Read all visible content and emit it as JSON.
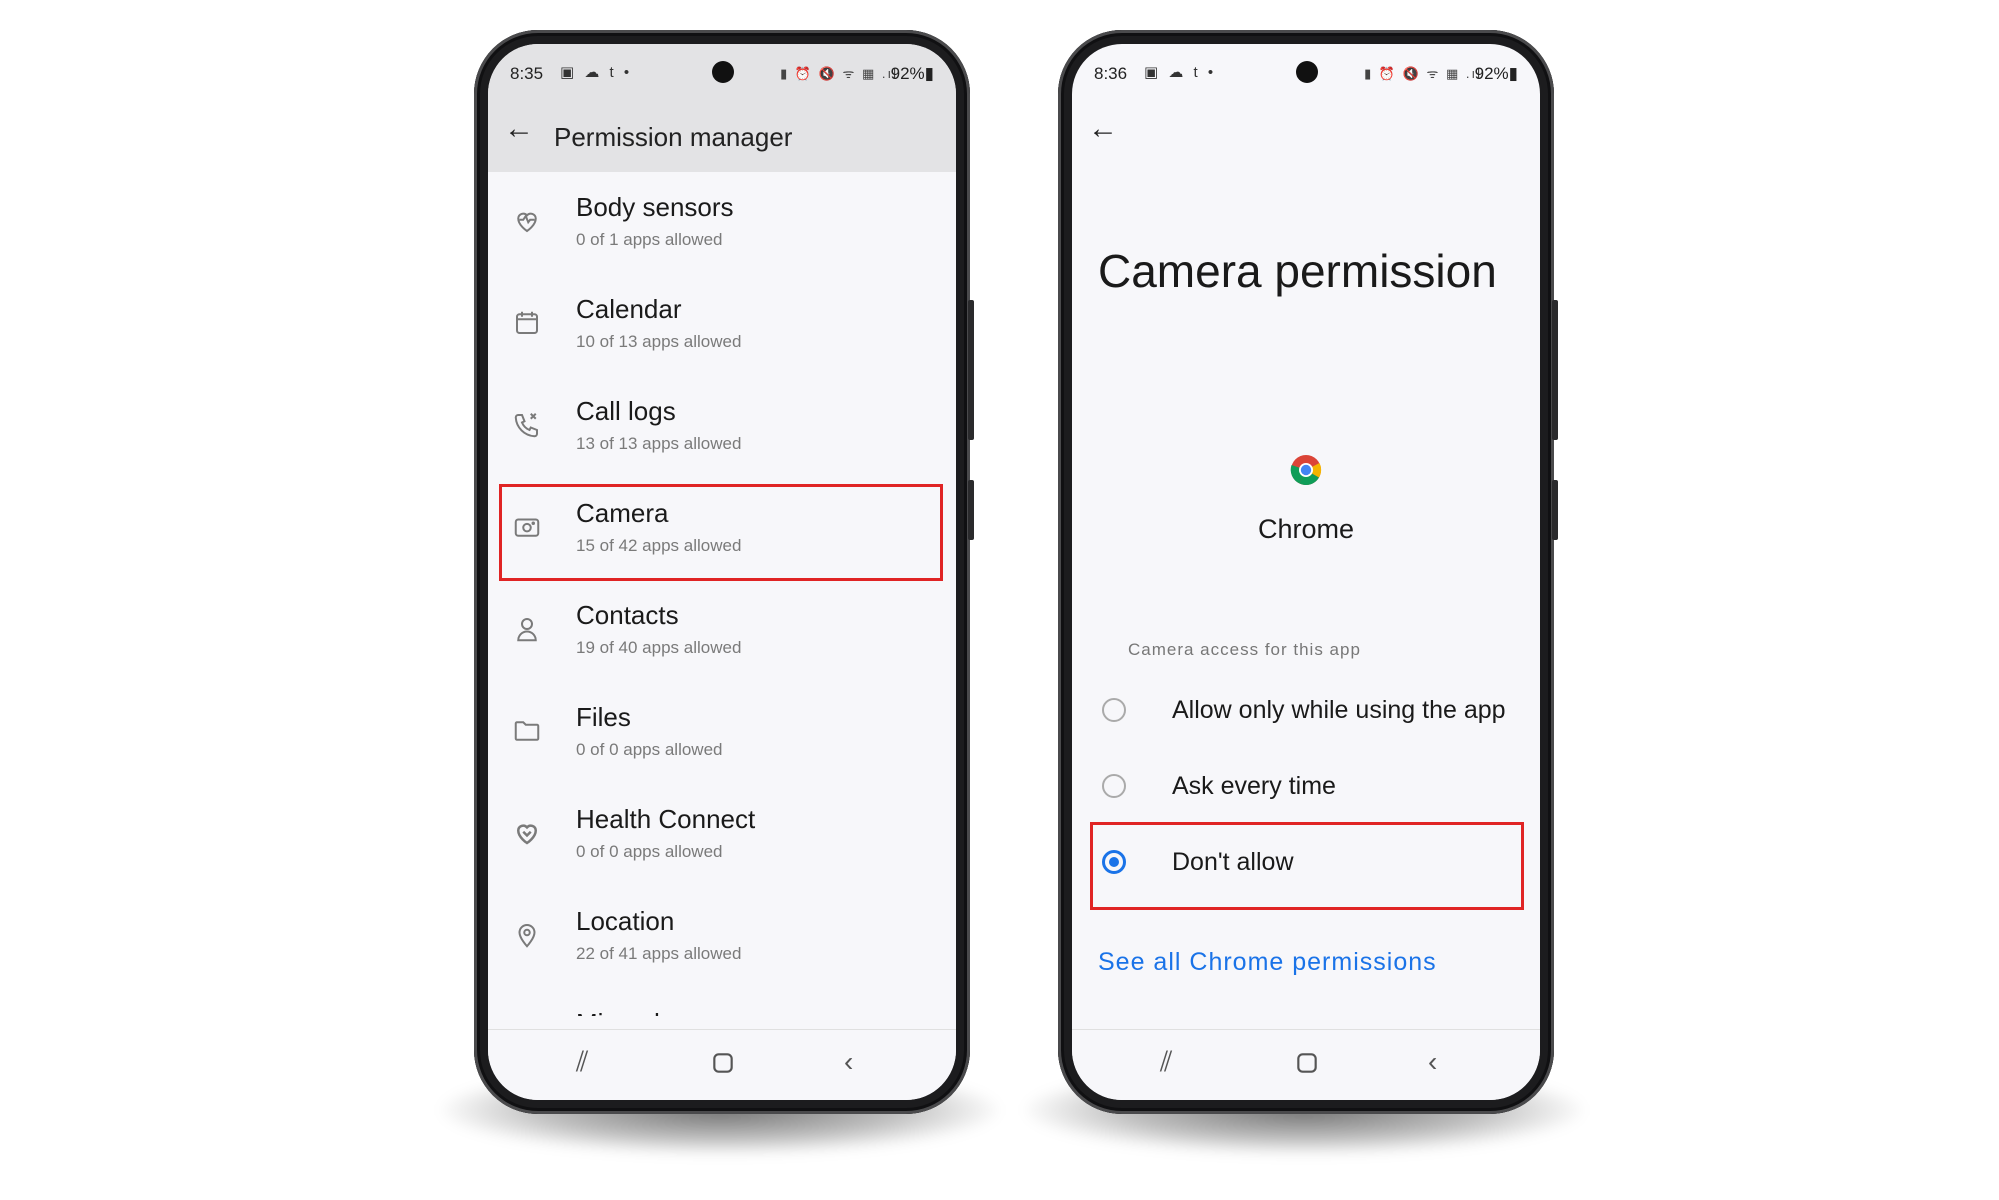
{
  "left_phone": {
    "status": {
      "time": "8:35",
      "left_icons": "▣ ☁ t •",
      "right_icons": "▮ ⏰ 🔇 ᯤ ▦ .ıl",
      "battery": "92%▮"
    },
    "app_bar": {
      "title": "Permission manager"
    },
    "permissions": [
      {
        "title": "Body sensors",
        "subtitle": "0 of 1 apps allowed",
        "icon": "heart-pulse-icon"
      },
      {
        "title": "Calendar",
        "subtitle": "10 of 13 apps allowed",
        "icon": "calendar-icon"
      },
      {
        "title": "Call logs",
        "subtitle": "13 of 13 apps allowed",
        "icon": "call-log-icon"
      },
      {
        "title": "Camera",
        "subtitle": "15 of 42 apps allowed",
        "icon": "camera-icon"
      },
      {
        "title": "Contacts",
        "subtitle": "19 of 40 apps allowed",
        "icon": "person-icon"
      },
      {
        "title": "Files",
        "subtitle": "0 of 0 apps allowed",
        "icon": "folder-icon"
      },
      {
        "title": "Health Connect",
        "subtitle": "0 of 0 apps allowed",
        "icon": "health-connect-icon"
      },
      {
        "title": "Location",
        "subtitle": "22 of 41 apps allowed",
        "icon": "location-pin-icon"
      },
      {
        "title": "Microphone",
        "subtitle": "",
        "icon": "microphone-icon"
      }
    ],
    "highlighted_item": "Camera"
  },
  "right_phone": {
    "status": {
      "time": "8:36",
      "left_icons": "▣ ☁ t •",
      "right_icons": "▮ ⏰ 🔇 ᯤ ▦ .ıl",
      "battery": "92%▮"
    },
    "title": "Camera permission",
    "app_name": "Chrome",
    "section_label": "Camera access for this app",
    "options": [
      {
        "label": "Allow only while using the app",
        "selected": false
      },
      {
        "label": "Ask every time",
        "selected": false
      },
      {
        "label": "Don't allow",
        "selected": true
      }
    ],
    "link": "See all Chrome permissions",
    "colors": {
      "accent": "#1a73e8",
      "highlight": "#e02424"
    }
  }
}
